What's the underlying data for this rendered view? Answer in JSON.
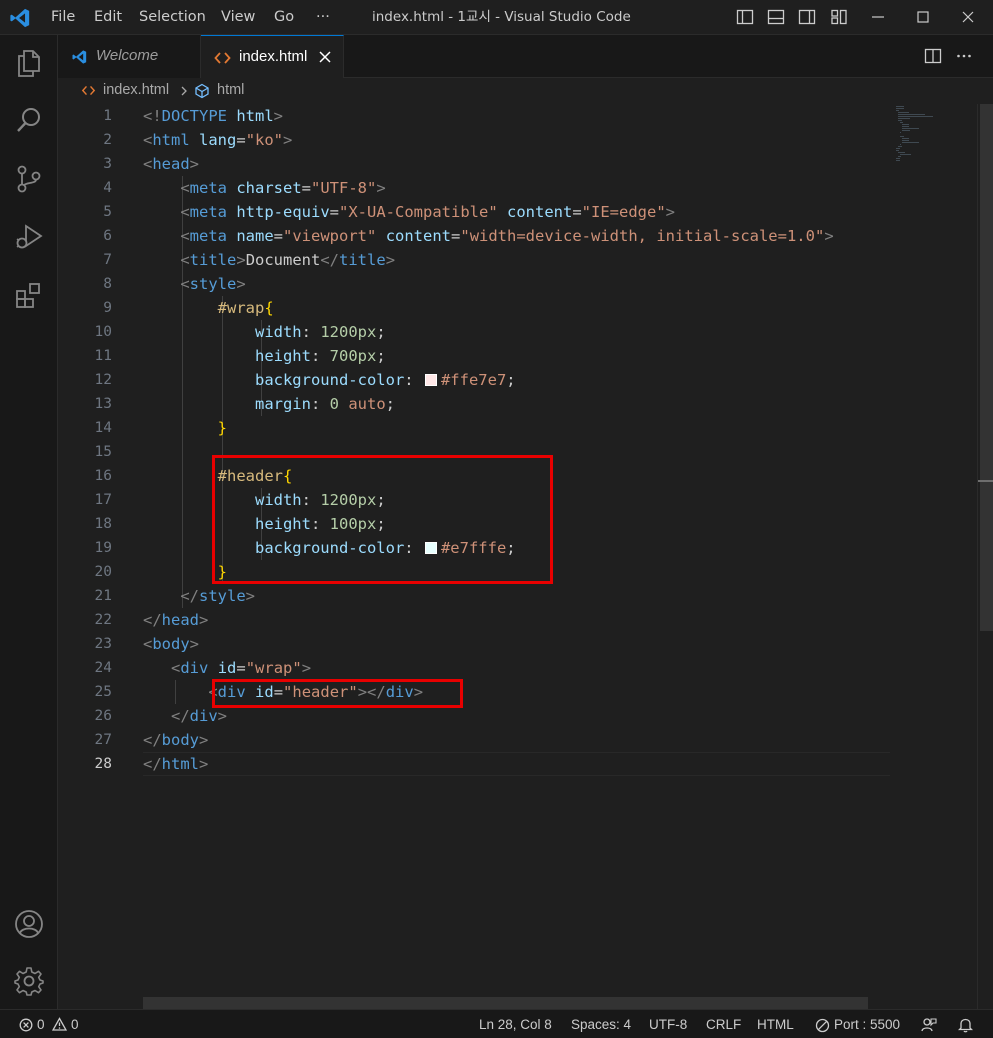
{
  "titlebar": {
    "menu": [
      "File",
      "Edit",
      "Selection",
      "View",
      "Go",
      "···"
    ],
    "title": "index.html - 1교시 - Visual Studio Code"
  },
  "tabs": [
    {
      "label": "Welcome",
      "active": false,
      "icon": "vscode-icon"
    },
    {
      "label": "index.html",
      "active": true,
      "icon": "html-icon"
    }
  ],
  "breadcrumb": {
    "file": "index.html",
    "symbol": "html"
  },
  "editor": {
    "active_line": 28,
    "line_numbers": [
      "1",
      "2",
      "3",
      "4",
      "5",
      "6",
      "7",
      "8",
      "9",
      "10",
      "11",
      "12",
      "13",
      "14",
      "15",
      "16",
      "17",
      "18",
      "19",
      "20",
      "21",
      "22",
      "23",
      "24",
      "25",
      "26",
      "27",
      "28"
    ],
    "lines": [
      [
        [
          "punc",
          "<!"
        ],
        [
          "tag",
          "DOCTYPE"
        ],
        [
          "text",
          " "
        ],
        [
          "attr",
          "html"
        ],
        [
          "punc",
          ">"
        ]
      ],
      [
        [
          "punc",
          "<"
        ],
        [
          "tag",
          "html"
        ],
        [
          "text",
          " "
        ],
        [
          "attr",
          "lang"
        ],
        [
          "text",
          "="
        ],
        [
          "str",
          "\"ko\""
        ],
        [
          "punc",
          ">"
        ]
      ],
      [
        [
          "punc",
          "<"
        ],
        [
          "tag",
          "head"
        ],
        [
          "punc",
          ">"
        ]
      ],
      [
        [
          "text",
          "    "
        ],
        [
          "punc",
          "<"
        ],
        [
          "tag",
          "meta"
        ],
        [
          "text",
          " "
        ],
        [
          "attr",
          "charset"
        ],
        [
          "text",
          "="
        ],
        [
          "str",
          "\"UTF-8\""
        ],
        [
          "punc",
          ">"
        ]
      ],
      [
        [
          "text",
          "    "
        ],
        [
          "punc",
          "<"
        ],
        [
          "tag",
          "meta"
        ],
        [
          "text",
          " "
        ],
        [
          "attr",
          "http-equiv"
        ],
        [
          "text",
          "="
        ],
        [
          "str",
          "\"X-UA-Compatible\""
        ],
        [
          "text",
          " "
        ],
        [
          "attr",
          "content"
        ],
        [
          "text",
          "="
        ],
        [
          "str",
          "\"IE=edge\""
        ],
        [
          "punc",
          ">"
        ]
      ],
      [
        [
          "text",
          "    "
        ],
        [
          "punc",
          "<"
        ],
        [
          "tag",
          "meta"
        ],
        [
          "text",
          " "
        ],
        [
          "attr",
          "name"
        ],
        [
          "text",
          "="
        ],
        [
          "str",
          "\"viewport\""
        ],
        [
          "text",
          " "
        ],
        [
          "attr",
          "content"
        ],
        [
          "text",
          "="
        ],
        [
          "str",
          "\"width=device-width, initial-scale=1.0\""
        ],
        [
          "punc",
          ">"
        ]
      ],
      [
        [
          "text",
          "    "
        ],
        [
          "punc",
          "<"
        ],
        [
          "tag",
          "title"
        ],
        [
          "punc",
          ">"
        ],
        [
          "text",
          "Document"
        ],
        [
          "punc",
          "</"
        ],
        [
          "tag",
          "title"
        ],
        [
          "punc",
          ">"
        ]
      ],
      [
        [
          "text",
          "    "
        ],
        [
          "punc",
          "<"
        ],
        [
          "tag",
          "style"
        ],
        [
          "punc",
          ">"
        ]
      ],
      [
        [
          "text",
          "        "
        ],
        [
          "sel",
          "#wrap"
        ],
        [
          "brace",
          "{"
        ]
      ],
      [
        [
          "text",
          "            "
        ],
        [
          "prop",
          "width"
        ],
        [
          "text",
          ": "
        ],
        [
          "num",
          "1200px"
        ],
        [
          "text",
          ";"
        ]
      ],
      [
        [
          "text",
          "            "
        ],
        [
          "prop",
          "height"
        ],
        [
          "text",
          ": "
        ],
        [
          "num",
          "700px"
        ],
        [
          "text",
          ";"
        ]
      ],
      [
        [
          "text",
          "            "
        ],
        [
          "prop",
          "background-color"
        ],
        [
          "text",
          ": "
        ],
        [
          "swatch",
          "#ffe7e7"
        ],
        [
          "val",
          "#ffe7e7"
        ],
        [
          "text",
          ";"
        ]
      ],
      [
        [
          "text",
          "            "
        ],
        [
          "prop",
          "margin"
        ],
        [
          "text",
          ": "
        ],
        [
          "num",
          "0"
        ],
        [
          "text",
          " "
        ],
        [
          "val",
          "auto"
        ],
        [
          "text",
          ";"
        ]
      ],
      [
        [
          "text",
          "        "
        ],
        [
          "brace",
          "}"
        ]
      ],
      [],
      [
        [
          "text",
          "        "
        ],
        [
          "sel",
          "#header"
        ],
        [
          "brace",
          "{"
        ]
      ],
      [
        [
          "text",
          "            "
        ],
        [
          "prop",
          "width"
        ],
        [
          "text",
          ": "
        ],
        [
          "num",
          "1200px"
        ],
        [
          "text",
          ";"
        ]
      ],
      [
        [
          "text",
          "            "
        ],
        [
          "prop",
          "height"
        ],
        [
          "text",
          ": "
        ],
        [
          "num",
          "100px"
        ],
        [
          "text",
          ";"
        ]
      ],
      [
        [
          "text",
          "            "
        ],
        [
          "prop",
          "background-color"
        ],
        [
          "text",
          ": "
        ],
        [
          "swatch",
          "#e7fffe"
        ],
        [
          "val",
          "#e7fffe"
        ],
        [
          "text",
          ";"
        ]
      ],
      [
        [
          "text",
          "        "
        ],
        [
          "brace",
          "}"
        ]
      ],
      [
        [
          "text",
          "    "
        ],
        [
          "punc",
          "</"
        ],
        [
          "tag",
          "style"
        ],
        [
          "punc",
          ">"
        ]
      ],
      [
        [
          "punc",
          "</"
        ],
        [
          "tag",
          "head"
        ],
        [
          "punc",
          ">"
        ]
      ],
      [
        [
          "punc",
          "<"
        ],
        [
          "tag",
          "body"
        ],
        [
          "punc",
          ">"
        ]
      ],
      [
        [
          "text",
          "   "
        ],
        [
          "punc",
          "<"
        ],
        [
          "tag",
          "div"
        ],
        [
          "text",
          " "
        ],
        [
          "attr",
          "id"
        ],
        [
          "text",
          "="
        ],
        [
          "str",
          "\"wrap\""
        ],
        [
          "punc",
          ">"
        ]
      ],
      [
        [
          "text",
          "       "
        ],
        [
          "punc",
          "<"
        ],
        [
          "tag",
          "div"
        ],
        [
          "text",
          " "
        ],
        [
          "attr",
          "id"
        ],
        [
          "text",
          "="
        ],
        [
          "str",
          "\"header\""
        ],
        [
          "punc",
          "></"
        ],
        [
          "tag",
          "div"
        ],
        [
          "punc",
          ">"
        ]
      ],
      [
        [
          "text",
          "   "
        ],
        [
          "punc",
          "</"
        ],
        [
          "tag",
          "div"
        ],
        [
          "punc",
          ">"
        ]
      ],
      [
        [
          "punc",
          "</"
        ],
        [
          "tag",
          "body"
        ],
        [
          "punc",
          ">"
        ]
      ],
      [
        [
          "punc",
          "</"
        ],
        [
          "tag",
          "html"
        ],
        [
          "punc",
          ">"
        ]
      ]
    ]
  },
  "statusbar": {
    "errors": "0",
    "warnings": "0",
    "position": "Ln 28, Col 8",
    "spaces": "Spaces: 4",
    "encoding": "UTF-8",
    "eol": "CRLF",
    "language": "HTML",
    "port": "Port : 5500"
  },
  "colors": {
    "accent": "#0078d4",
    "highlight_box": "#e80000",
    "editor_bg": "#1f1f1f"
  }
}
